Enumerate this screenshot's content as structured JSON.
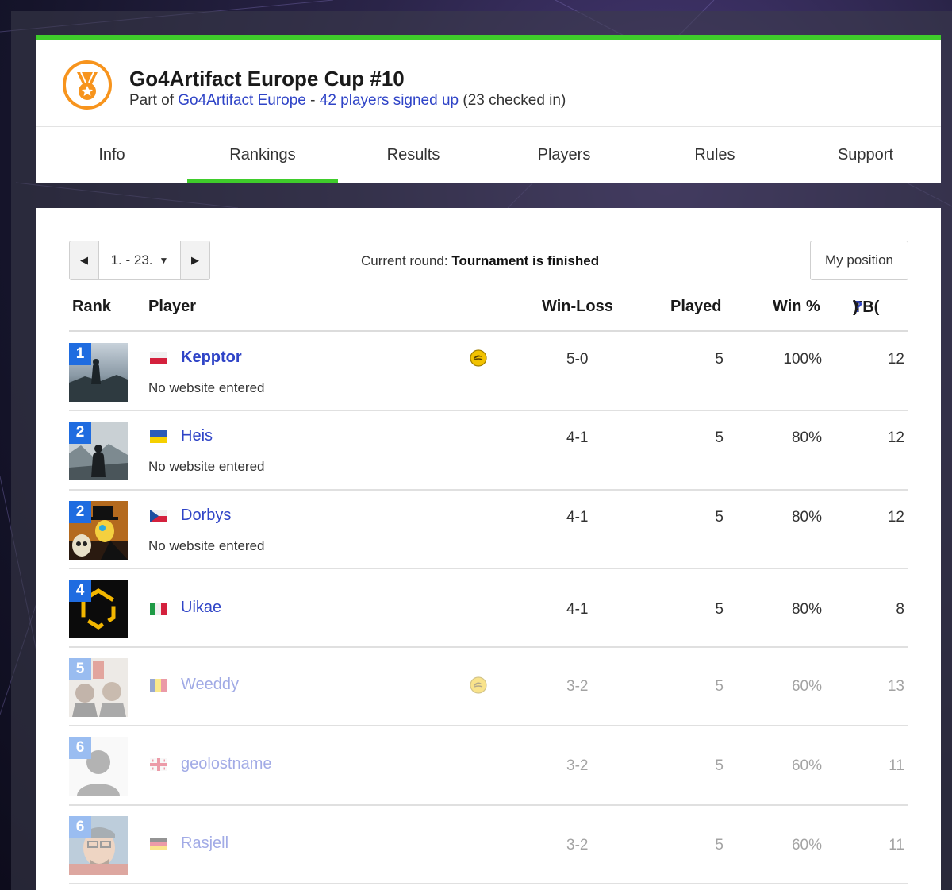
{
  "tournament": {
    "title": "Go4Artifact Europe Cup #10",
    "part_of_label": "Part of",
    "series_link": "Go4Artifact Europe",
    "separator": "-",
    "signed_up_link": "42 players signed up",
    "checked_in": "(23 checked in)"
  },
  "tabs": [
    {
      "label": "Info",
      "active": false
    },
    {
      "label": "Rankings",
      "active": true
    },
    {
      "label": "Results",
      "active": false
    },
    {
      "label": "Players",
      "active": false
    },
    {
      "label": "Rules",
      "active": false
    },
    {
      "label": "Support",
      "active": false
    }
  ],
  "toolbar": {
    "range": "1. - 23.",
    "current_round_label": "Current round:",
    "current_round_value": "Tournament is finished",
    "my_position": "My position"
  },
  "table": {
    "headers": {
      "rank": "Rank",
      "player": "Player",
      "win_loss": "Win-Loss",
      "played": "Played",
      "win_pct": "Win %",
      "tb_prefix": "TB(",
      "tb_help": "?",
      "tb_suffix": ")"
    },
    "rows": [
      {
        "rank": "1",
        "name": "Kepptor",
        "website": "No website entered",
        "win_loss": "5-0",
        "played": "5",
        "win_pct": "100%",
        "tb": "12",
        "flag": "poland",
        "premium": true
      },
      {
        "rank": "2",
        "name": "Heis",
        "website": "No website entered",
        "win_loss": "4-1",
        "played": "5",
        "win_pct": "80%",
        "tb": "12",
        "flag": "ukraine",
        "premium": false
      },
      {
        "rank": "2",
        "name": "Dorbys",
        "website": "No website entered",
        "win_loss": "4-1",
        "played": "5",
        "win_pct": "80%",
        "tb": "12",
        "flag": "czech",
        "premium": false
      },
      {
        "rank": "4",
        "name": "Uikae",
        "website": "",
        "win_loss": "4-1",
        "played": "5",
        "win_pct": "80%",
        "tb": "8",
        "flag": "italy",
        "premium": false
      },
      {
        "rank": "5",
        "name": "Weeddy",
        "website": "",
        "win_loss": "3-2",
        "played": "5",
        "win_pct": "60%",
        "tb": "13",
        "flag": "romania",
        "premium": true
      },
      {
        "rank": "6",
        "name": "geolostname",
        "website": "",
        "win_loss": "3-2",
        "played": "5",
        "win_pct": "60%",
        "tb": "11",
        "flag": "georgia",
        "premium": false
      },
      {
        "rank": "6",
        "name": "Rasjell",
        "website": "",
        "win_loss": "3-2",
        "played": "5",
        "win_pct": "60%",
        "tb": "11",
        "flag": "germany",
        "premium": false
      }
    ]
  },
  "colors": {
    "accent_green": "#3fcc2b",
    "link_blue": "#2f44c7",
    "badge_blue": "#1f6ce0",
    "medal_orange": "#f7941d"
  }
}
